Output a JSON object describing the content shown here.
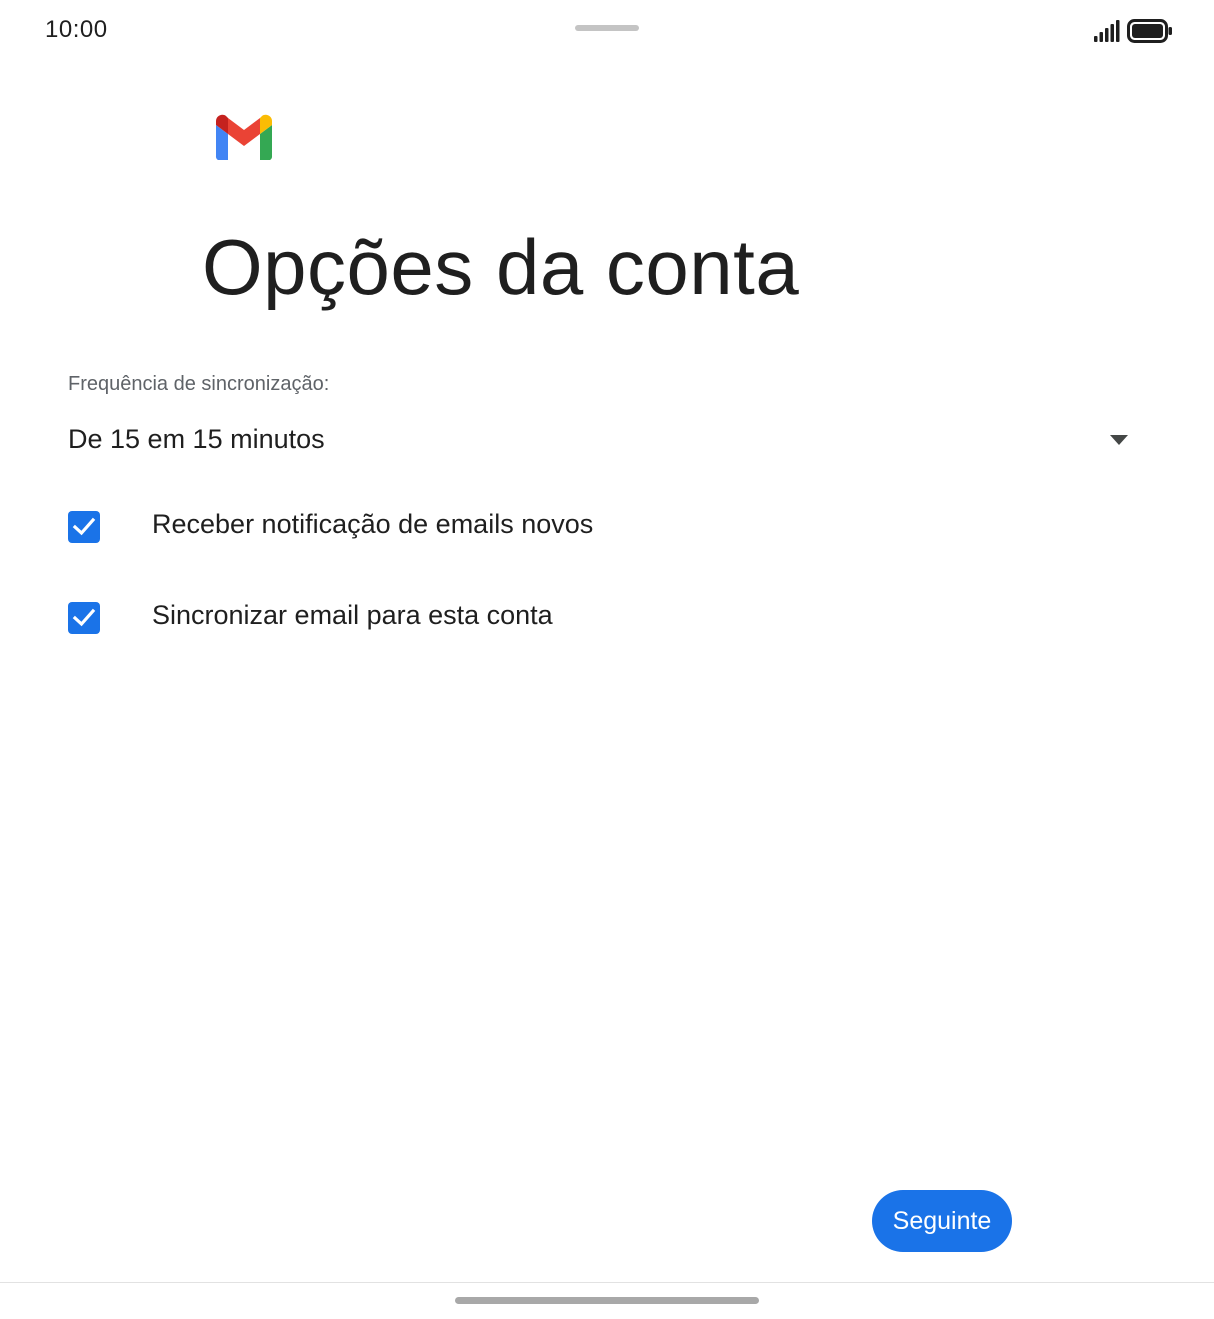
{
  "status_bar": {
    "time": "10:00",
    "signal_icon": "signal-icon",
    "battery_icon": "battery-icon"
  },
  "logo": {
    "icon": "gmail-logo-icon",
    "colors": {
      "red": "#ea4335",
      "blue": "#4285f4",
      "green": "#34a853",
      "yellow": "#fbbc04",
      "dark_red": "#c5221f"
    }
  },
  "header": {
    "title": "Opções da conta"
  },
  "sync": {
    "label": "Frequência de sincronização:",
    "selected": "De 15 em 15 minutos",
    "dropdown_icon": "chevron-down-icon"
  },
  "options": [
    {
      "label": "Receber notificação de emails novos",
      "checked": true
    },
    {
      "label": "Sincronizar email para esta conta",
      "checked": true
    }
  ],
  "actions": {
    "next_label": "Seguinte"
  },
  "theme": {
    "accent": "#1a73e8",
    "text": "#1f1f1f",
    "secondary_text": "#5f6368"
  }
}
